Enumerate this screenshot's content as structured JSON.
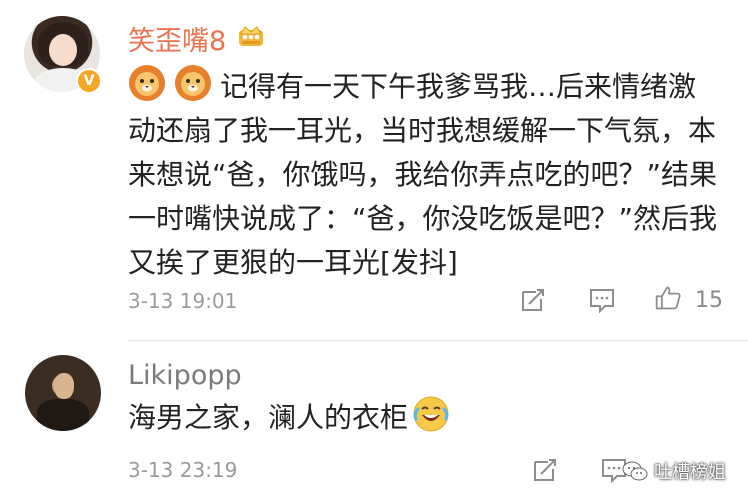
{
  "comments": [
    {
      "username": "笑歪嘴8",
      "verified_badge": "V",
      "member_icon": "crown-icon",
      "emoji_prefix": [
        "lion-emoji",
        "lion-emoji"
      ],
      "text": "记得有一天下午我爹骂我…后来情绪激动还扇了我一耳光，当时我想缓解一下气氛，本来想说“爸，你饿吗，我给你弄点吃的吧？”结果一时嘴快说成了：“爸，你没吃饭是吧？”然后我又挨了更狠的一耳光[发抖]",
      "time": "3-13 19:01",
      "like_count": "15"
    },
    {
      "username": "Likipopp",
      "text": "海男之家，澜人的衣柜",
      "emoji_suffix": "laugh-cry-emoji",
      "time": "3-13 23:19"
    }
  ],
  "watermark": {
    "text": "吐槽榜姐"
  },
  "colors": {
    "username_vip": "#eb7350",
    "username_normal": "#7a7a7a",
    "text": "#222222",
    "meta": "#9a9a9a",
    "badge": "#f5a623"
  }
}
